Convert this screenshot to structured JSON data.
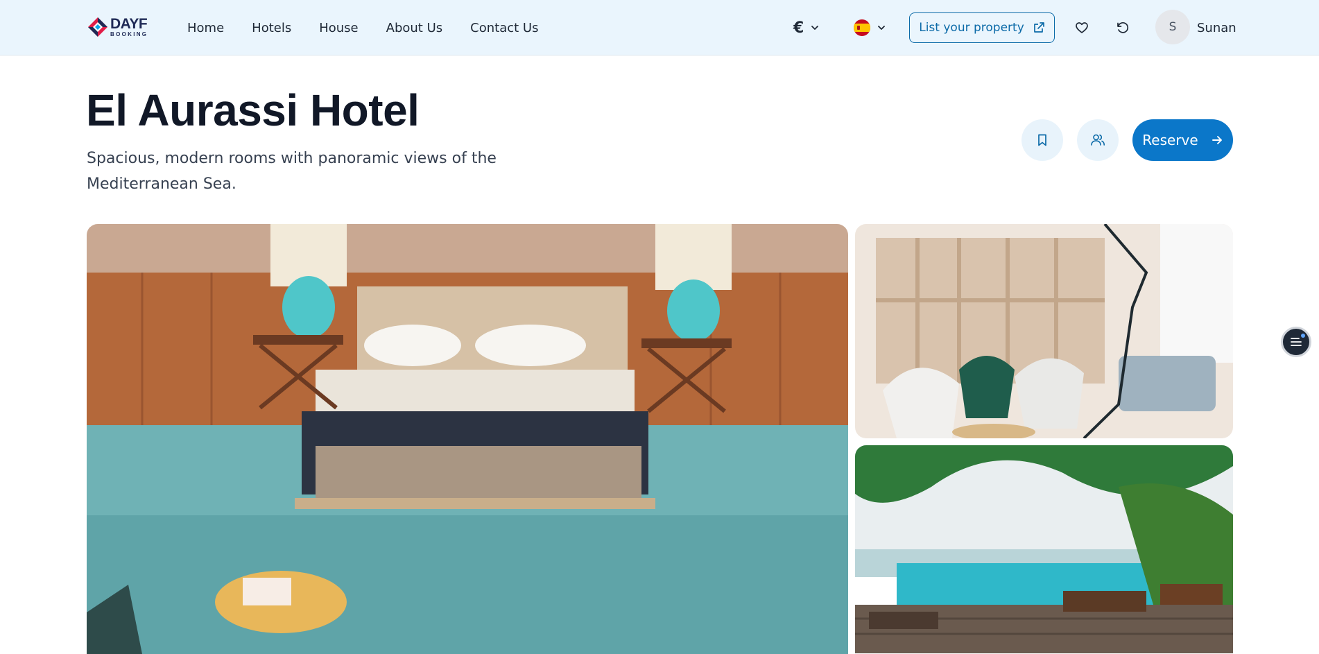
{
  "brand": {
    "name": "DAYF",
    "tagline": "BOOKING"
  },
  "nav": {
    "items": [
      {
        "label": "Home"
      },
      {
        "label": "Hotels"
      },
      {
        "label": "House"
      },
      {
        "label": "About Us"
      },
      {
        "label": "Contact Us"
      }
    ]
  },
  "header": {
    "currency_symbol": "€",
    "language_flag": "spain-flag",
    "list_property_label": "List your property",
    "user": {
      "initial": "S",
      "name": "Sunan"
    }
  },
  "hotel": {
    "title": "El Aurassi Hotel",
    "description": "Spacious, modern rooms with panoramic views of the Mediterranean Sea.",
    "reserve_label": "Reserve"
  },
  "gallery": {
    "images": [
      {
        "subject": "hotel-bedroom-photo"
      },
      {
        "subject": "lounge-area-photo"
      },
      {
        "subject": "pool-beach-photo"
      }
    ]
  },
  "colors": {
    "accent": "#0b77c9",
    "header_bg": "#eaf5fd",
    "outline": "#0b6aa8"
  }
}
